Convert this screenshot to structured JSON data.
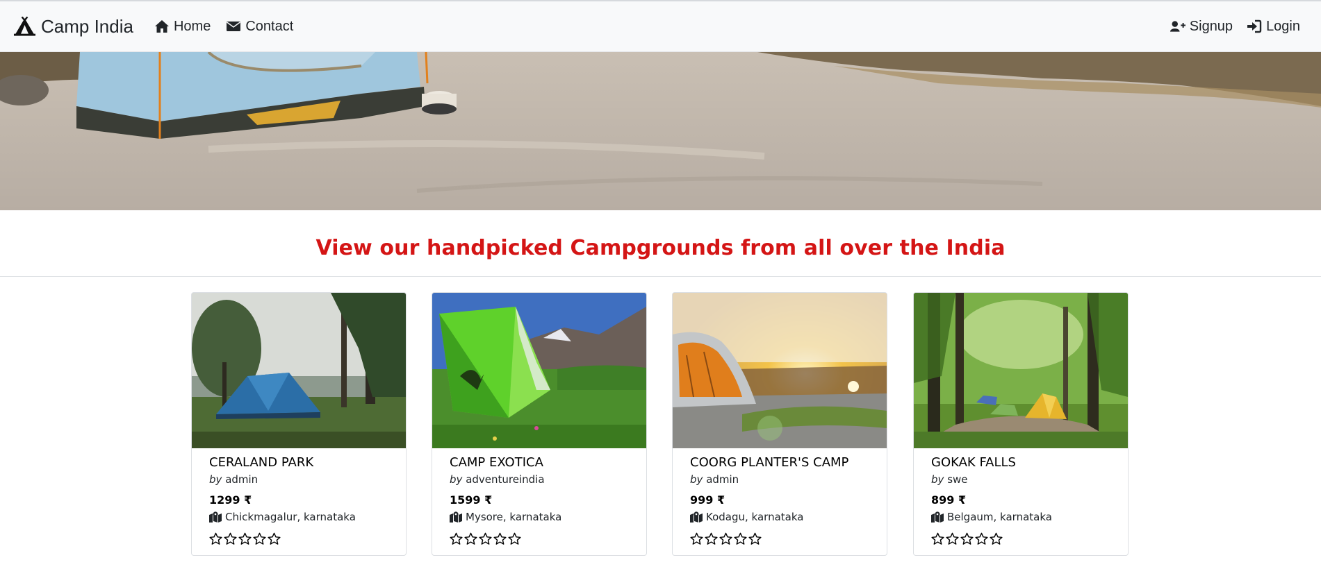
{
  "navbar": {
    "brand": "Camp India",
    "brand_icon": "campground-icon",
    "links": [
      {
        "label": "Home",
        "icon": "home-icon"
      },
      {
        "label": "Contact",
        "icon": "envelope-icon"
      }
    ],
    "right_links": [
      {
        "label": "Signup",
        "icon": "user-plus-icon"
      },
      {
        "label": "Login",
        "icon": "sign-in-icon"
      }
    ]
  },
  "headline": "View our handpicked Campgrounds from all over the India",
  "campgrounds": [
    {
      "title": "CERALAND PARK",
      "by": "by",
      "author": "admin",
      "price": "1299 ₹",
      "location": "Chickmagalur, karnataka",
      "rating": 0,
      "icon": "map-marked-icon"
    },
    {
      "title": "CAMP EXOTICA",
      "by": "by",
      "author": "adventureindia",
      "price": "1599 ₹",
      "location": "Mysore, karnataka",
      "rating": 0,
      "icon": "map-marked-icon"
    },
    {
      "title": "COORG PLANTER'S CAMP",
      "by": "by",
      "author": "admin",
      "price": "999 ₹",
      "location": "Kodagu, karnataka",
      "rating": 0,
      "icon": "map-marked-icon"
    },
    {
      "title": "GOKAK FALLS",
      "by": "by",
      "author": "swe",
      "price": "899 ₹",
      "location": "Belgaum, karnataka",
      "rating": 0,
      "icon": "map-marked-icon"
    }
  ],
  "colors": {
    "headline": "#d41515",
    "navbar_bg": "#f8f9fa"
  }
}
